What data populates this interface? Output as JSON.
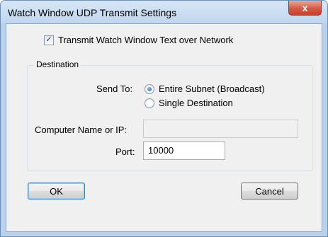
{
  "window": {
    "title": "Watch Window UDP Transmit Settings",
    "close_glyph": "x"
  },
  "transmit_checkbox": {
    "label": "Transmit Watch Window Text over Network",
    "checked": true,
    "glyph": "✓"
  },
  "destination": {
    "legend": "Destination",
    "send_to_label": "Send To:",
    "options": [
      {
        "label": "Entire Subnet (Broadcast)",
        "selected": true
      },
      {
        "label": "Single Destination",
        "selected": false
      }
    ],
    "computer_label": "Computer Name or IP:",
    "computer_value": "",
    "port_label": "Port:",
    "port_value": "10000"
  },
  "buttons": {
    "ok": "OK",
    "cancel": "Cancel"
  }
}
